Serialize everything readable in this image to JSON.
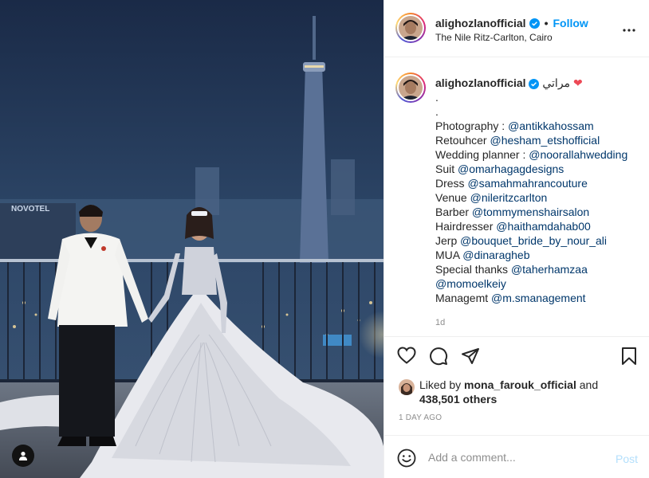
{
  "post": {
    "username": "alighozlanofficial",
    "verified": true,
    "follow_label": "Follow",
    "location": "The Nile Ritz-Carlton, Cairo",
    "header_separator": "•"
  },
  "photo": {
    "sign_text": "NOVOTEL",
    "alt": "Wedding couple on a rooftop at night with the Cairo Tower behind"
  },
  "caption": {
    "username": "alighozlanofficial",
    "first_text": "مراتي",
    "emoji": "❤",
    "lines": [
      {
        "text": "."
      },
      {
        "text": "."
      },
      {
        "text": "Photography : ",
        "mention": "@antikkahossam"
      },
      {
        "text": "Retouhcer ",
        "mention": "@hesham_etshofficial"
      },
      {
        "text": "Wedding planner : ",
        "mention": "@noorallahwedding"
      },
      {
        "text": "Suit ",
        "mention": "@omarhagagdesigns"
      },
      {
        "text": "Dress ",
        "mention": "@samahmahrancouture"
      },
      {
        "text": "Venue ",
        "mention": "@nileritzcarlton"
      },
      {
        "text": "Barber ",
        "mention": "@tommymenshairsalon"
      },
      {
        "text": "Hairdresser ",
        "mention": "@haithamdahab00"
      },
      {
        "text": "Jerp ",
        "mention": "@bouquet_bride_by_nour_ali"
      },
      {
        "text": "MUA ",
        "mention": "@dinaragheb"
      },
      {
        "text": "Special thanks ",
        "mention": "@taherhamzaa"
      },
      {
        "text": "",
        "mention": "@momoelkeiy"
      },
      {
        "text": "Managemt ",
        "mention": "@m.smanagement"
      }
    ],
    "age": "1d"
  },
  "actions": {
    "icons": [
      "heart-icon",
      "comment-icon",
      "share-icon",
      "bookmark-icon"
    ]
  },
  "likes": {
    "prefix": "Liked by ",
    "liker": "mona_farouk_official",
    "connector": " and",
    "others": "438,501 others"
  },
  "timestamp": "1 DAY AGO",
  "comment_box": {
    "placeholder": "Add a comment...",
    "post_label": "Post"
  },
  "colors": {
    "accent": "#0095f6",
    "mention": "#00376b",
    "muted": "#8e8e8e",
    "heart": "#ed4956",
    "post_disabled": "#b3dffc"
  }
}
